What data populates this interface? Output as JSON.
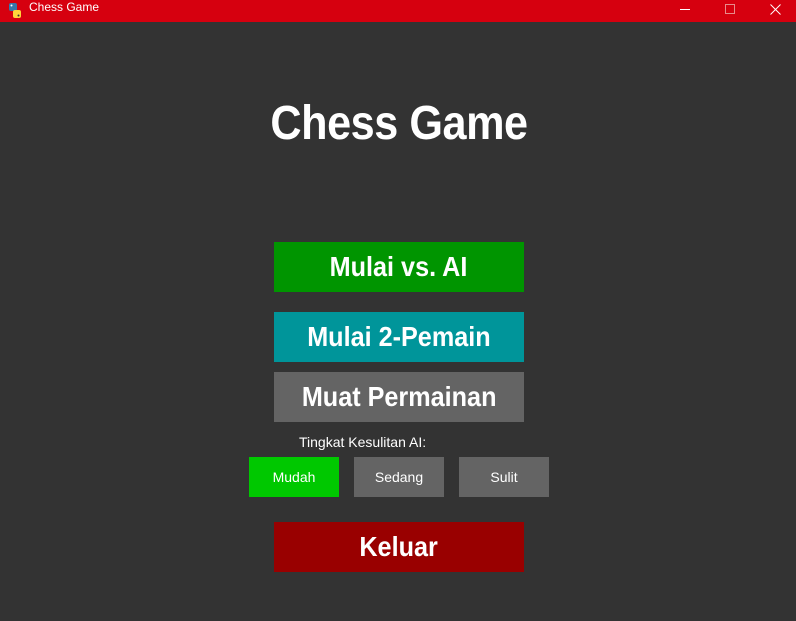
{
  "window": {
    "title": "Chess Game",
    "titlebar_color": "#d6000f"
  },
  "main": {
    "title": "Chess Game",
    "buttons": {
      "vs_ai": "Mulai vs. AI",
      "two_player": "Mulai 2-Pemain",
      "load_game": "Muat Permainan",
      "quit": "Keluar"
    },
    "difficulty": {
      "label": "Tingkat Kesulitan AI:",
      "options": [
        "Mudah",
        "Sedang",
        "Sulit"
      ],
      "selected": "Mudah"
    }
  },
  "colors": {
    "background": "#333333",
    "vs_ai": "#009500",
    "two_player": "#00959a",
    "load_game": "#646464",
    "quit": "#990000",
    "difficulty_selected": "#00c800",
    "difficulty_unselected": "#646464"
  },
  "icons": {
    "app": "python-icon",
    "minimize": "minimize-icon",
    "maximize": "maximize-icon",
    "close": "close-icon"
  }
}
